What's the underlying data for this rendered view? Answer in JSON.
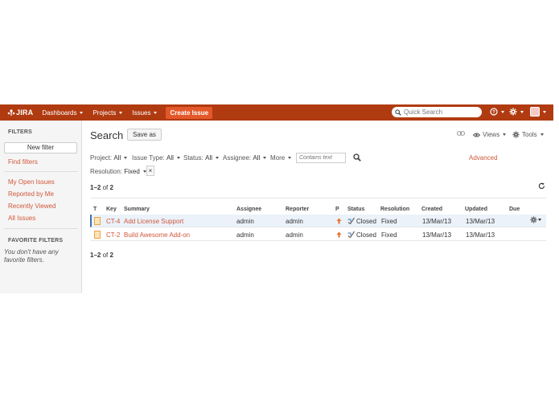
{
  "header": {
    "brand": "JIRA",
    "nav": [
      "Dashboards",
      "Projects",
      "Issues"
    ],
    "create_label": "Create Issue",
    "search_placeholder": "Quick Search",
    "colors": {
      "bar": "#b13b11",
      "create": "#e3582a",
      "link": "#d0573a"
    }
  },
  "sidebar": {
    "filters_title": "FILTERS",
    "new_filter_label": "New filter",
    "find_filters": "Find filters",
    "links": [
      "My Open Issues",
      "Reported by Me",
      "Recently Viewed",
      "All Issues"
    ],
    "favorites_title": "FAVORITE FILTERS",
    "favorites_note": "You don't have any favorite filters."
  },
  "search": {
    "title": "Search",
    "save_as_label": "Save as",
    "views_label": "Views",
    "tools_label": "Tools",
    "filters": [
      {
        "label": "Project:",
        "value": "All"
      },
      {
        "label": "Issue Type:",
        "value": "All"
      },
      {
        "label": "Status:",
        "value": "All"
      },
      {
        "label": "Assignee:",
        "value": "All"
      }
    ],
    "more_label": "More",
    "contains_placeholder": "Contains text",
    "advanced_label": "Advanced",
    "resolution": {
      "label": "Resolution:",
      "value": "Fixed"
    },
    "remove_label": "×"
  },
  "results": {
    "count_range": "1–2",
    "count_of": "of",
    "count_total": "2",
    "columns": [
      "T",
      "Key",
      "Summary",
      "Assignee",
      "Reporter",
      "P",
      "Status",
      "Resolution",
      "Created",
      "Updated",
      "Due"
    ],
    "rows": [
      {
        "key": "CT-4",
        "summary": "Add License Support",
        "assignee": "admin",
        "reporter": "admin",
        "status": "Closed",
        "resolution": "Fixed",
        "created": "13/Mar/13",
        "updated": "13/Mar/13",
        "due": ""
      },
      {
        "key": "CT-2",
        "summary": "Build Awesome Add-on",
        "assignee": "admin",
        "reporter": "admin",
        "status": "Closed",
        "resolution": "Fixed",
        "created": "13/Mar/13",
        "updated": "13/Mar/13",
        "due": ""
      }
    ]
  }
}
